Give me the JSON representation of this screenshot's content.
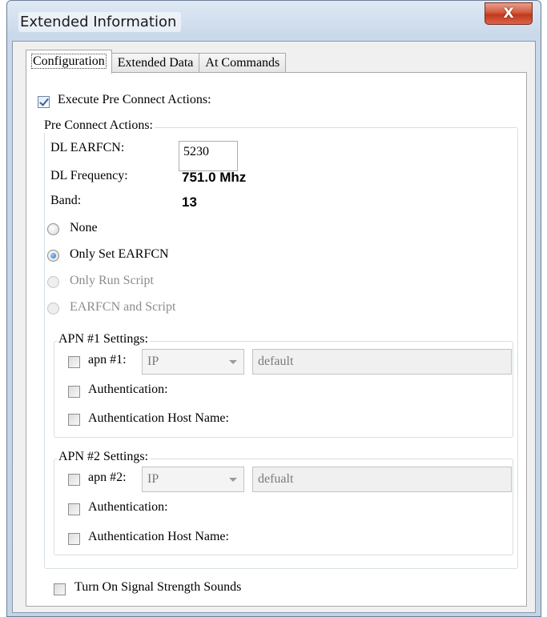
{
  "window": {
    "title": "Extended Information",
    "close_label": "X"
  },
  "tabs": [
    {
      "label": "Configuration",
      "active": true
    },
    {
      "label": "Extended Data",
      "active": false
    },
    {
      "label": "At Commands",
      "active": false
    }
  ],
  "execute_pre_connect": {
    "label": "Execute Pre Connect Actions:",
    "checked": true
  },
  "pre_connect": {
    "group_title": "Pre Connect Actions:",
    "dl_earfcn_label": "DL EARFCN:",
    "dl_earfcn_value": "5230",
    "dl_frequency_label": "DL Frequency:",
    "dl_frequency_value": "751.0 Mhz",
    "band_label": "Band:",
    "band_value": "13",
    "radio_options": [
      {
        "label": "None",
        "selected": false,
        "enabled": true
      },
      {
        "label": "Only Set EARFCN",
        "selected": true,
        "enabled": true
      },
      {
        "label": "Only Run Script",
        "selected": false,
        "enabled": false
      },
      {
        "label": "EARFCN and Script",
        "selected": false,
        "enabled": false
      }
    ]
  },
  "apn1": {
    "group_title": "APN #1 Settings:",
    "apn_label": "apn #1:",
    "apn_checked": false,
    "type_value": "IP",
    "name_value": "default",
    "auth_label": "Authentication:",
    "auth_checked": false,
    "host_label": "Authentication Host Name:",
    "host_checked": false
  },
  "apn2": {
    "group_title": "APN #2 Settings:",
    "apn_label": "apn #2:",
    "apn_checked": false,
    "type_value": "IP",
    "name_value": "defualt",
    "auth_label": "Authentication:",
    "auth_checked": false,
    "host_label": "Authentication Host Name:",
    "host_checked": false
  },
  "signal_sounds": {
    "label": "Turn On Signal Strength Sounds",
    "checked": false
  }
}
